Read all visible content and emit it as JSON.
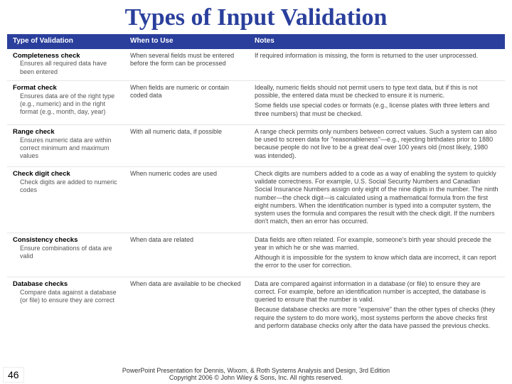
{
  "title": "Types of Input Validation",
  "headers": {
    "c1": "Type of Validation",
    "c2": "When to Use",
    "c3": "Notes"
  },
  "rows": [
    {
      "name": "Completeness check",
      "desc": "Ensures all required data have been entered",
      "when": "When several fields must be entered before the form can be processed",
      "notes": [
        "If required information is missing, the form is returned to the user unprocessed."
      ]
    },
    {
      "name": "Format check",
      "desc": "Ensures data are of the right type (e.g., numeric) and in the right format (e.g., month, day, year)",
      "when": "When fields are numeric or contain coded data",
      "notes": [
        "Ideally, numeric fields should not permit users to type text data, but if this is not possible, the entered data must be checked to ensure it is numeric.",
        "Some fields use special codes or formats (e.g., license plates with three letters and three numbers) that must be checked."
      ]
    },
    {
      "name": "Range check",
      "desc": "Ensures numeric data are within correct minimum and maximum values",
      "when": "With all numeric data, if possible",
      "notes": [
        "A range check permits only numbers between correct values. Such a system can also be used to screen data for \"reasonableness\"—e.g., rejecting birthdates prior to 1880 because people do not live to be a great deal over 100 years old (most likely, 1980 was intended)."
      ]
    },
    {
      "name": "Check digit check",
      "desc": "Check digits are added to numeric codes",
      "when": "When numeric codes are used",
      "notes": [
        "Check digits are numbers added to a code as a way of enabling the system to quickly validate correctness. For example, U.S. Social Security Numbers and Canadian Social Insurance Numbers assign only eight of the nine digits in the number. The ninth number—the check digit—is calculated using a mathematical formula from the first eight numbers. When the identification number is typed into a computer system, the system uses the formula and compares the result with the check digit. If the numbers don't match, then an error has occurred."
      ]
    },
    {
      "name": "Consistency checks",
      "desc": "Ensure combinations of data are valid",
      "when": "When data are related",
      "notes": [
        "Data fields are often related. For example, someone's birth year should precede the year in which he or she was married.",
        "Although it is impossible for the system to know which data are incorrect, it can report the error to the user for correction."
      ]
    },
    {
      "name": "Database checks",
      "desc": "Compare data against a database (or file) to ensure they are correct",
      "when": "When data are available to be checked",
      "notes": [
        "Data are compared against information in a database (or file) to ensure they are correct. For example, before an identification number is accepted, the database is queried to ensure that the number is valid.",
        "Because database checks are more \"expensive\" than the other types of checks (they require the system to do more work), most systems perform the above checks first and perform database checks only after the data have passed the previous checks."
      ]
    }
  ],
  "footer": {
    "l1": "PowerPoint Presentation for Dennis, Wixom, & Roth Systems Analysis and Design, 3rd Edition",
    "l2": "Copyright 2006 © John Wiley & Sons, Inc. All rights reserved."
  },
  "page": "46"
}
